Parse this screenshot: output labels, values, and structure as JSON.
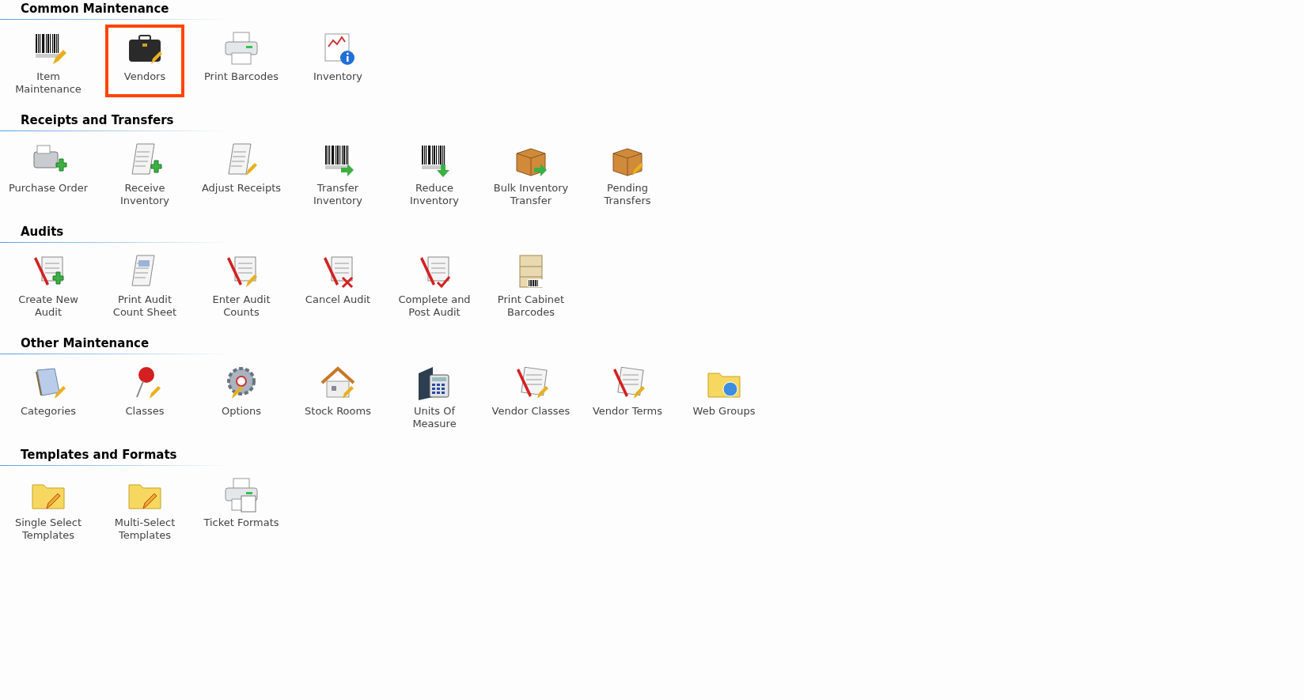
{
  "sections": [
    {
      "title": "Common Maintenance",
      "items": [
        {
          "label": "Item Maintenance",
          "kind": "barcode-pencil",
          "selected": false
        },
        {
          "label": "Vendors",
          "kind": "briefcase",
          "selected": true
        },
        {
          "label": "Print Barcodes",
          "kind": "printer",
          "selected": false
        },
        {
          "label": "Inventory",
          "kind": "report-info",
          "selected": false
        }
      ]
    },
    {
      "title": "Receipts and Transfers",
      "items": [
        {
          "label": "Purchase Order",
          "kind": "machine-plus",
          "selected": false
        },
        {
          "label": "Receive Inventory",
          "kind": "receipt-plus",
          "selected": false
        },
        {
          "label": "Adjust Receipts",
          "kind": "receipt-pencil",
          "selected": false
        },
        {
          "label": "Transfer Inventory",
          "kind": "barcode-right",
          "selected": false
        },
        {
          "label": "Reduce Inventory",
          "kind": "barcode-down",
          "selected": false
        },
        {
          "label": "Bulk Inventory Transfer",
          "kind": "box-arrow",
          "selected": false
        },
        {
          "label": "Pending Transfers",
          "kind": "box-pencil",
          "selected": false
        }
      ]
    },
    {
      "title": "Audits",
      "items": [
        {
          "label": "Create New Audit",
          "kind": "audit-plus",
          "selected": false
        },
        {
          "label": "Print Audit Count Sheet",
          "kind": "sheet",
          "selected": false
        },
        {
          "label": "Enter Audit Counts",
          "kind": "audit-pencil",
          "selected": false
        },
        {
          "label": "Cancel Audit",
          "kind": "audit-x",
          "selected": false
        },
        {
          "label": "Complete and Post Audit",
          "kind": "audit-check",
          "selected": false
        },
        {
          "label": "Print Cabinet Barcodes",
          "kind": "cabinet",
          "selected": false
        }
      ]
    },
    {
      "title": "Other Maintenance",
      "items": [
        {
          "label": "Categories",
          "kind": "notebook",
          "selected": false
        },
        {
          "label": "Classes",
          "kind": "pushpin",
          "selected": false
        },
        {
          "label": "Options",
          "kind": "gear",
          "selected": false
        },
        {
          "label": "Stock Rooms",
          "kind": "house",
          "selected": false
        },
        {
          "label": "Units Of Measure",
          "kind": "calculator",
          "selected": false
        },
        {
          "label": "Vendor Classes",
          "kind": "papers-pencil",
          "selected": false
        },
        {
          "label": "Vendor Terms",
          "kind": "papers-pencil",
          "selected": false
        },
        {
          "label": "Web Groups",
          "kind": "folder-globe",
          "selected": false
        }
      ]
    },
    {
      "title": "Templates and Formats",
      "items": [
        {
          "label": "Single Select Templates",
          "kind": "folder-pencil",
          "selected": false
        },
        {
          "label": "Multi-Select Templates",
          "kind": "folder-pencil",
          "selected": false
        },
        {
          "label": "Ticket Formats",
          "kind": "printer-doc",
          "selected": false
        }
      ]
    }
  ]
}
